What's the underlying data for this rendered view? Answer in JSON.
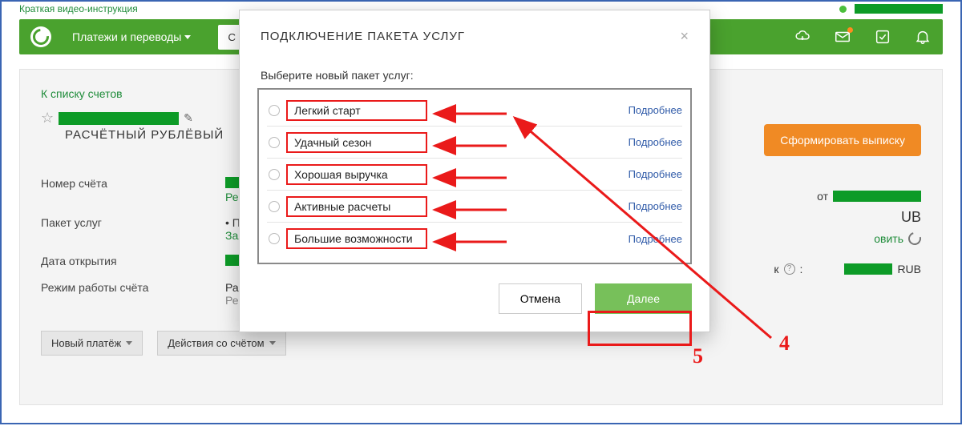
{
  "topstrip": {
    "video_link": "Краткая видео-инструкция"
  },
  "header": {
    "nav_label": "Платежи и переводы",
    "search_value": "Сч"
  },
  "panel": {
    "back_link": "К списку счетов",
    "account_subtitle": "РАСЧЁТНЫЙ РУБЛЁВЫЙ",
    "fields": {
      "num_label": "Номер счёта",
      "rekv": "Рекв",
      "pkg_label": "Пакет услуг",
      "pkg_val_prefix": "• Пак",
      "pkg_val_link": "Заяв",
      "open_label": "Дата открытия",
      "mode_label": "Режим работы счёта",
      "mode_val1": "Расш",
      "mode_val2": "Реше"
    },
    "btn_new": "Новый платёж",
    "btn_actions": "Действия со счётом",
    "orange_btn": "Сформировать выписку"
  },
  "rightcol": {
    "row1_prefix": "от ",
    "row2": "UB",
    "row3_link": "овить",
    "row4_prefix": "к",
    "row4_suffix": "RUB",
    "qmark": "?"
  },
  "modal": {
    "title": "ПОДКЛЮЧЕНИЕ ПАКЕТА УСЛУГ",
    "prompt": "Выберите новый пакет услуг:",
    "options": [
      {
        "label": "Легкий старт",
        "more": "Подробнее"
      },
      {
        "label": "Удачный сезон",
        "more": "Подробнее"
      },
      {
        "label": "Хорошая выручка",
        "more": "Подробнее"
      },
      {
        "label": "Активные расчеты",
        "more": "Подробнее"
      },
      {
        "label": "Большие возможности",
        "more": "Подробнее"
      }
    ],
    "cancel": "Отмена",
    "next": "Далее"
  },
  "annotations": {
    "num4": "4",
    "num5": "5"
  }
}
